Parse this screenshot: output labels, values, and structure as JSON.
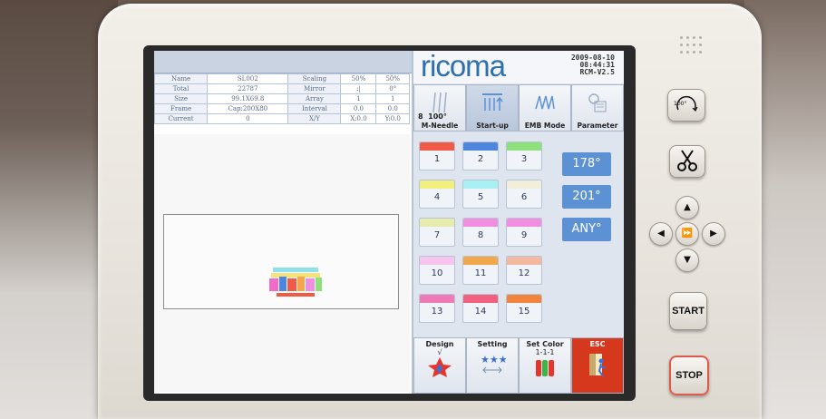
{
  "info_table": {
    "rows": [
      {
        "label": "Name",
        "value": "SL002",
        "label2": "Scaling",
        "v1": "50%",
        "v2": "50%"
      },
      {
        "label": "Total",
        "value": "22787",
        "label2": "Mirror",
        "v1": ":|",
        "v2": "0°"
      },
      {
        "label": "Size",
        "value": "99.1X69.8",
        "label2": "Array",
        "v1": "1",
        "v2": "1"
      },
      {
        "label": "Frame",
        "value": "Cap:200X80",
        "label2": "Interval",
        "v1": "0.0",
        "v2": "0.0"
      },
      {
        "label": "Current",
        "value": "0",
        "label2": "X/Y",
        "v1": "X:0.0",
        "v2": "Y:0.0"
      }
    ]
  },
  "logo": "ricoma",
  "date": "2009-08-10",
  "time": "08:44:31",
  "version": "RCM-V2.5",
  "modes": [
    {
      "label": "M-Needle",
      "needles": "8",
      "angle": "100°"
    },
    {
      "label": "Start-up"
    },
    {
      "label": "EMB Mode"
    },
    {
      "label": "Parameter"
    }
  ],
  "needle_colors": [
    {
      "num": "1",
      "color": "#f25a48"
    },
    {
      "num": "2",
      "color": "#4f86dd"
    },
    {
      "num": "3",
      "color": "#8ee07a"
    },
    {
      "num": "4",
      "color": "#f1f07c"
    },
    {
      "num": "5",
      "color": "#a8f0f2"
    },
    {
      "num": "6",
      "color": "#f1efd9"
    },
    {
      "num": "7",
      "color": "#e6ecae"
    },
    {
      "num": "8",
      "color": "#f08fe0"
    },
    {
      "num": "9",
      "color": "#f08fe0"
    },
    {
      "num": "10",
      "color": "#f6c4ec"
    },
    {
      "num": "11",
      "color": "#f2a84a"
    },
    {
      "num": "12",
      "color": "#f2b9a0"
    },
    {
      "num": "13",
      "color": "#ef7ab8"
    },
    {
      "num": "14",
      "color": "#f2607f"
    },
    {
      "num": "15",
      "color": "#f2833b"
    }
  ],
  "angles": [
    "178°",
    "201°",
    "ANY°"
  ],
  "bottom_buttons": [
    {
      "label": "Design",
      "sub": "√"
    },
    {
      "label": "Setting",
      "sub": ""
    },
    {
      "label": "Set Color",
      "sub": "1-1-1"
    },
    {
      "label": "ESC",
      "sub": ""
    }
  ],
  "hardware": {
    "speed_label": "100°",
    "start_label": "START",
    "stop_label": "STOP"
  }
}
